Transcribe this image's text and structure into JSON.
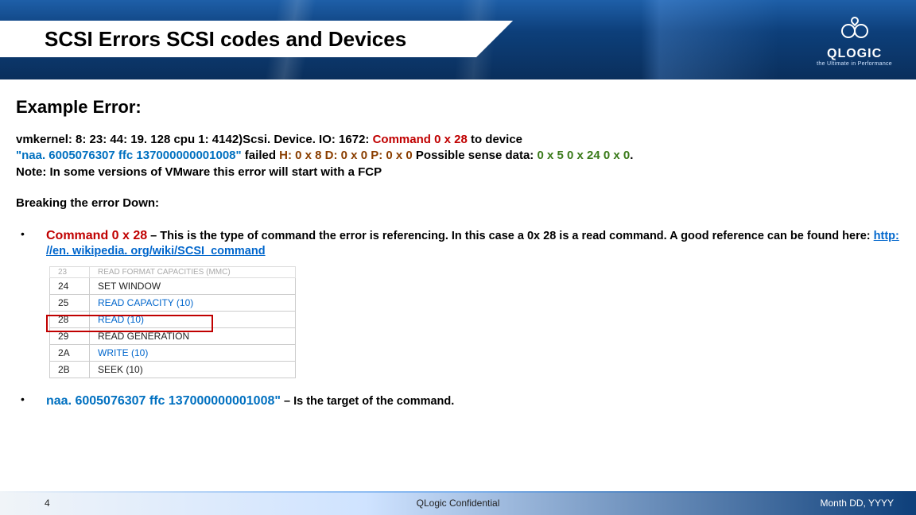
{
  "header": {
    "title": "SCSI Errors SCSI codes and Devices",
    "logo_text": "QLOGIC",
    "logo_tagline": "the Ultimate in Performance"
  },
  "example": {
    "heading": "Example Error:",
    "line_pre": "vmkernel: 8: 23: 44: 19. 128 cpu 1: 4142)Scsi. Device. IO: 1672: ",
    "cmd": "Command 0 x 28",
    "line_mid1": " to device ",
    "naa": "\"naa. 6005076307 ffc 137000000001008\"",
    "line_mid2": " failed ",
    "hdp": "H: 0 x 8 D: 0 x 0 P: 0 x 0",
    "line_mid3": " Possible sense data: ",
    "sense": "0 x 5 0 x 24 0 x 0",
    "period": ".",
    "note": "Note: In some versions of VMware this error will start with a FCP"
  },
  "breaking": "Breaking the error Down:",
  "bullet1": {
    "lead": "Command 0 x 28",
    "body_pre": " – This is the type of command the error is referencing.  In this case a 0x 28 is a read command. A good reference can be found here: ",
    "link": "http: //en. wikipedia. org/wiki/SCSI_command"
  },
  "table": {
    "rows": [
      {
        "code": "24",
        "name": "SET WINDOW",
        "link": false
      },
      {
        "code": "25",
        "name": "READ CAPACITY (10)",
        "link": true
      },
      {
        "code": "28",
        "name": "READ (10)",
        "link": true
      },
      {
        "code": "29",
        "name": "READ GENERATION",
        "link": false
      },
      {
        "code": "2A",
        "name": "WRITE (10)",
        "link": true
      },
      {
        "code": "2B",
        "name": "SEEK (10)",
        "link": false
      }
    ]
  },
  "bullet2": {
    "lead": "naa. 6005076307 ffc 137000000001008\"",
    "body": " – Is the target of the command."
  },
  "footer": {
    "page": "4",
    "confidential": "QLogic Confidential",
    "date": "Month DD, YYYY"
  }
}
